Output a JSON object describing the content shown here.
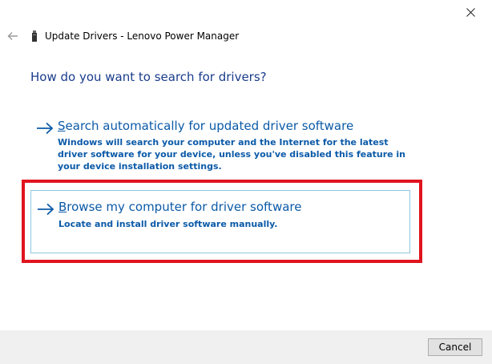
{
  "window": {
    "title": "Update Drivers - Lenovo Power Manager",
    "close_icon": "close-icon",
    "back_icon": "back-arrow-icon",
    "device_icon": "device-icon"
  },
  "heading": "How do you want to search for drivers?",
  "options": [
    {
      "title_first": "S",
      "title_rest": "earch automatically for updated driver software",
      "description": "Windows will search your computer and the Internet for the latest driver software for your device, unless you've disabled this feature in your device installation settings."
    },
    {
      "title_first": "B",
      "title_rest": "rowse my computer for driver software",
      "description": "Locate and install driver software manually."
    }
  ],
  "footer": {
    "cancel_label": "Cancel"
  },
  "colors": {
    "link_blue": "#0b5aa8",
    "heading_blue": "#1a3c8c",
    "highlight_red": "#e0141e"
  }
}
